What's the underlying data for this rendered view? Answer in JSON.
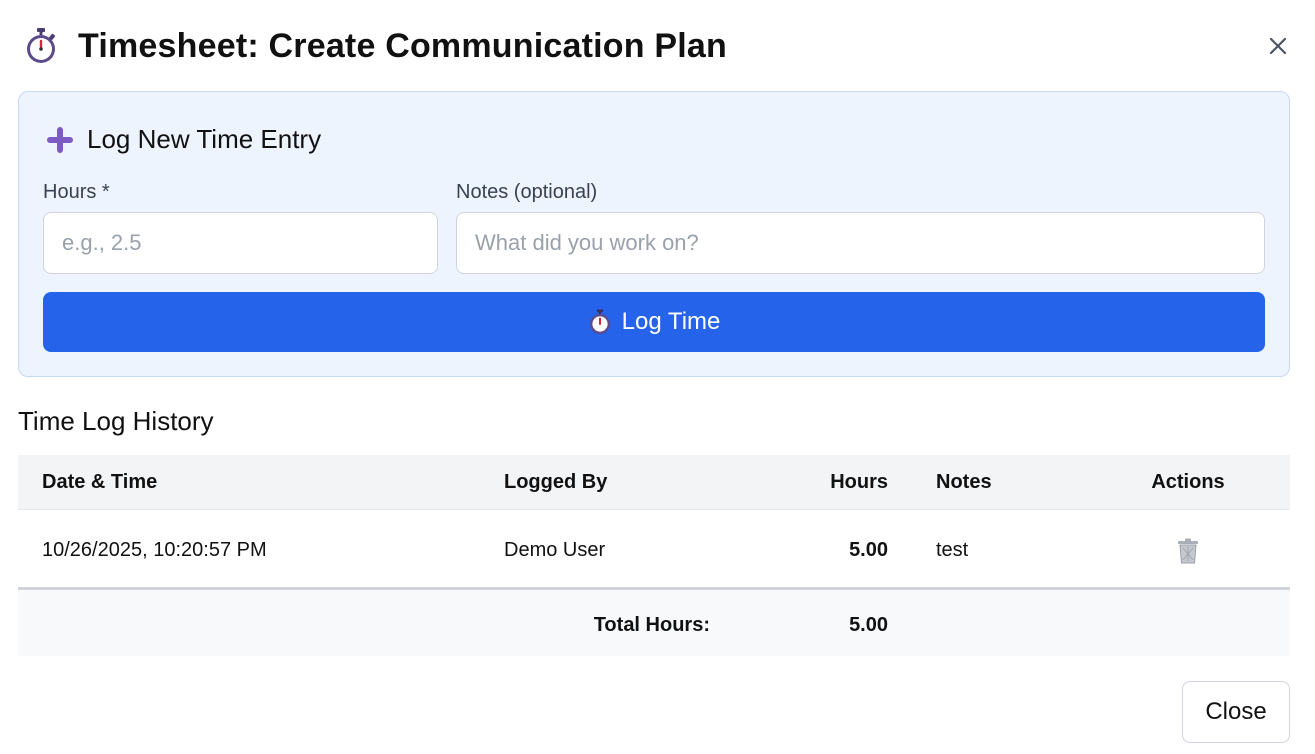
{
  "dialog": {
    "title": "Timesheet: Create Communication Plan",
    "title_icon": "stopwatch-icon",
    "close_icon": "close-icon"
  },
  "entry_form": {
    "heading": "Log New Time Entry",
    "heading_icon": "plus-icon",
    "hours_label": "Hours *",
    "hours_placeholder": "e.g., 2.5",
    "hours_value": "",
    "notes_label": "Notes (optional)",
    "notes_placeholder": "What did you work on?",
    "notes_value": "",
    "submit_label": "Log Time",
    "submit_icon": "stopwatch-icon"
  },
  "history": {
    "heading": "Time Log History",
    "columns": [
      "Date & Time",
      "Logged By",
      "Hours",
      "Notes",
      "Actions"
    ],
    "rows": [
      {
        "date_time": "10/26/2025, 10:20:57 PM",
        "logged_by": "Demo User",
        "hours": "5.00",
        "notes": "test",
        "action_icon": "trash-icon"
      }
    ],
    "total_label": "Total Hours:",
    "total_value": "5.00"
  },
  "footer": {
    "close_label": "Close"
  },
  "colors": {
    "primary": "#2563eb",
    "panel_bg": "#eef4fe",
    "panel_border": "#c6d8f5",
    "plus_icon": "#7c5cc4"
  }
}
